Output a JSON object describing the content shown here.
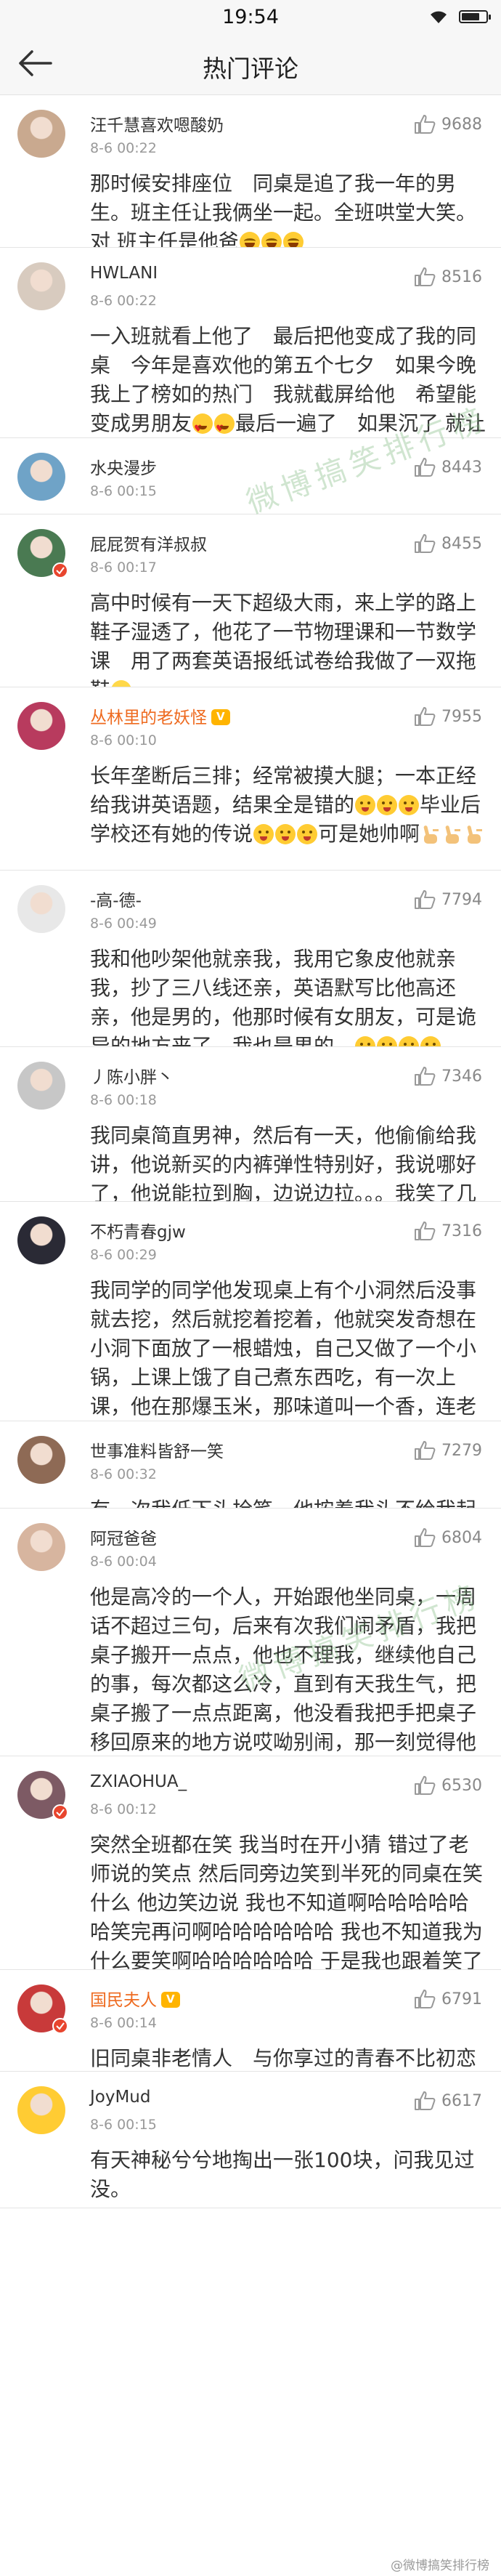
{
  "status_bar": {
    "time": "19:54",
    "battery_level": 0.75
  },
  "nav": {
    "title": "热门评论",
    "back_icon": "arrow-left-icon"
  },
  "watermark": "微博搞笑排行榜",
  "footer_mark": "@微博搞笑排行榜",
  "comments": [
    {
      "name": "汪千慧喜欢嗯酸奶",
      "date": "8-6 00:22",
      "likes": "9688",
      "verified": false,
      "vip": false,
      "text": "那时候安排座位　同桌是追了我一年的男生。班主任让我俩坐一起。全班哄堂大笑。对 班主任是他爸",
      "emoji_tail": [
        "laugh",
        "laugh",
        "laugh"
      ],
      "avatar_color": "#c9a98f"
    },
    {
      "name": "HWLANI",
      "date": "8-6 00:22",
      "likes": "8516",
      "verified": false,
      "vip": false,
      "text": "一入班就看上他了　最后把他变成了我的同桌　今年是喜欢他的第五个七夕　如果今晚我上了榜如的热门　我就截屏给他　希望能变成男朋友",
      "emoji_mid": [
        "hearteyes",
        "hearteyes"
      ],
      "text2": "最后一遍了　如果沉了 就让他在我心里多住几年　晚安",
      "avatar_color": "#d8cbbf"
    },
    {
      "name": "水央漫步",
      "date": "8-6 00:15",
      "likes": "8443",
      "verified": false,
      "vip": false,
      "text": "512地震时我以为那傻狗在踢我凳子",
      "avatar_color": "#6fa3c7"
    },
    {
      "name": "屁屁贺有洋叔叔",
      "date": "8-6 00:17",
      "likes": "8455",
      "verified": true,
      "vip": false,
      "text": "高中时候有一天下超级大雨，来上学的路上鞋子湿透了，他花了一节物理课和一节数学课　用了两套英语报纸试卷给我做了一双拖鞋",
      "emoji_tail": [
        "smile"
      ],
      "avatar_color": "#4a7a52"
    },
    {
      "name": "丛林里的老妖怪",
      "date": "8-6 00:10",
      "likes": "7955",
      "verified": false,
      "vip": true,
      "text": "长年垄断后三排；经常被摸大腿；一本正经给我讲英语题，结果全是错的",
      "emoji_mid": [
        "drool",
        "drool",
        "drool"
      ],
      "text2": "毕业后学校还有她的传说",
      "emoji_mid2": [
        "drool",
        "drool",
        "drool"
      ],
      "text3": "可是她帅啊",
      "emoji_tail": [
        "victory",
        "victory",
        "victory"
      ],
      "avatar_color": "#b83b5e"
    },
    {
      "name": "-高-德-",
      "date": "8-6 00:49",
      "likes": "7794",
      "verified": false,
      "vip": false,
      "text": "我和他吵架他就亲我，我用它象皮他就亲我，抄了三八线还亲，英语默写比他高还亲，他是男的，他那时候有女朋友，可是诡异的地方来了，我也是男的。",
      "emoji_tail": [
        "drool",
        "drool",
        "drool",
        "drool"
      ],
      "avatar_color": "#e8e8e8"
    },
    {
      "name": "丿陈小胖丶",
      "date": "8-6 00:18",
      "likes": "7346",
      "verified": false,
      "vip": false,
      "text": "我同桌简直男神，然后有一天，他偷偷给我讲，他说新买的内裤弹性特别好，我说哪好了，他说能拉到胸，边说边拉。。。我笑了几年",
      "emoji_tail": [
        "laugh"
      ],
      "avatar_color": "#c7c7c7"
    },
    {
      "name": "不朽青春gjw",
      "date": "8-6 00:29",
      "likes": "7316",
      "verified": false,
      "vip": false,
      "text": "我同学的同学他发现桌上有个小洞然后没事就去挖，然后就挖着挖着，他就突发奇想在小洞下面放了一根蜡烛，自己又做了一个小锅，上课上饿了自己煮东西吃，有一次上课，他在那爆玉米，那味道叫一个香，连老师都闻到了",
      "emoji_tail": [
        "smile"
      ],
      "avatar_color": "#2a2a35"
    },
    {
      "name": "世事准料皆舒一笑",
      "date": "8-6 00:32",
      "likes": "7279",
      "verified": false,
      "vip": false,
      "text": "有一次我低下头拴笔，他按着我头不给我起来",
      "emoji_tail": [
        "ghost"
      ],
      "avatar_color": "#8e6a55"
    },
    {
      "name": "阿冠爸爸",
      "date": "8-6 00:04",
      "likes": "6804",
      "verified": false,
      "vip": false,
      "text": "他是高冷的一个人，开始跟他坐同桌，一周话不超过三句，后来有次我们闹矛盾，我把桌子搬开一点点，他也不理我，继续他自己的事，每次都这么冷，直到有天我生气，把桌子搬了一点点距离，他没看我把手把桌子移回原来的地方说哎呦别闹，那一刻觉得他超级帅啊！现在他去当兵2年了，希望他以后好好的",
      "emoji_tail": [
        "laugh"
      ],
      "avatar_color": "#d7b59f"
    },
    {
      "name": "ZXIAOHUA_",
      "date": "8-6 00:12",
      "likes": "6530",
      "verified": true,
      "vip": false,
      "text": "突然全班都在笑 我当时在开小猜 错过了老师说的笑点 然后同旁边笑到半死的同桌在笑什么 他边笑边说 我也不知道啊哈哈哈哈哈哈笑完再问啊哈哈哈哈哈哈 我也不知道我为什么要笑啊哈哈哈哈哈哈 于是我也跟着笑了起来...",
      "avatar_color": "#7d5a64"
    },
    {
      "name": "国民夫人",
      "date": "8-6 00:14",
      "likes": "6791",
      "verified": true,
      "vip": true,
      "text": "旧同桌非老情人　与你享过的青春不比初恋少半分",
      "emoji_tail": [
        "heart"
      ],
      "avatar_color": "#c83a3a"
    },
    {
      "name": "JoyMud",
      "date": "8-6 00:15",
      "likes": "6617",
      "verified": false,
      "vip": false,
      "text": "有天神秘兮兮地掏出一张100块，问我见过没。",
      "avatar_color": "#ffcc33"
    }
  ]
}
